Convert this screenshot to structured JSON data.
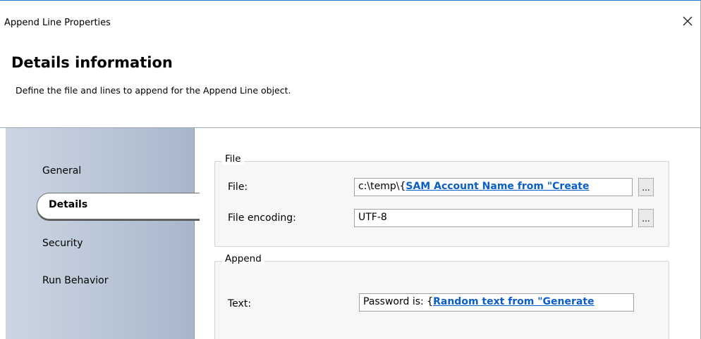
{
  "window": {
    "title": "Append Line Properties"
  },
  "header": {
    "title": "Details information",
    "subtitle": "Define the file and lines to append for the Append Line object."
  },
  "sidebar": {
    "items": [
      {
        "label": "General",
        "selected": false
      },
      {
        "label": "Details",
        "selected": true
      },
      {
        "label": "Security",
        "selected": false
      },
      {
        "label": "Run Behavior",
        "selected": false
      }
    ]
  },
  "file_group": {
    "legend": "File",
    "file_label": "File:",
    "file_value_prefix": "c:\\temp\\{",
    "file_value_token": "SAM Account Name from \"Create",
    "browse_label": "...",
    "encoding_label": "File encoding:",
    "encoding_value": "UTF-8"
  },
  "append_group": {
    "legend": "Append",
    "text_label": "Text:",
    "text_value_prefix": "Password is: {",
    "text_value_token": "Random text from \"Generate"
  },
  "colors": {
    "accent": "#1e78d4",
    "link": "#0a5ec8",
    "sidebar": "#b9c6d7"
  },
  "icons": {
    "close": "close-icon"
  }
}
